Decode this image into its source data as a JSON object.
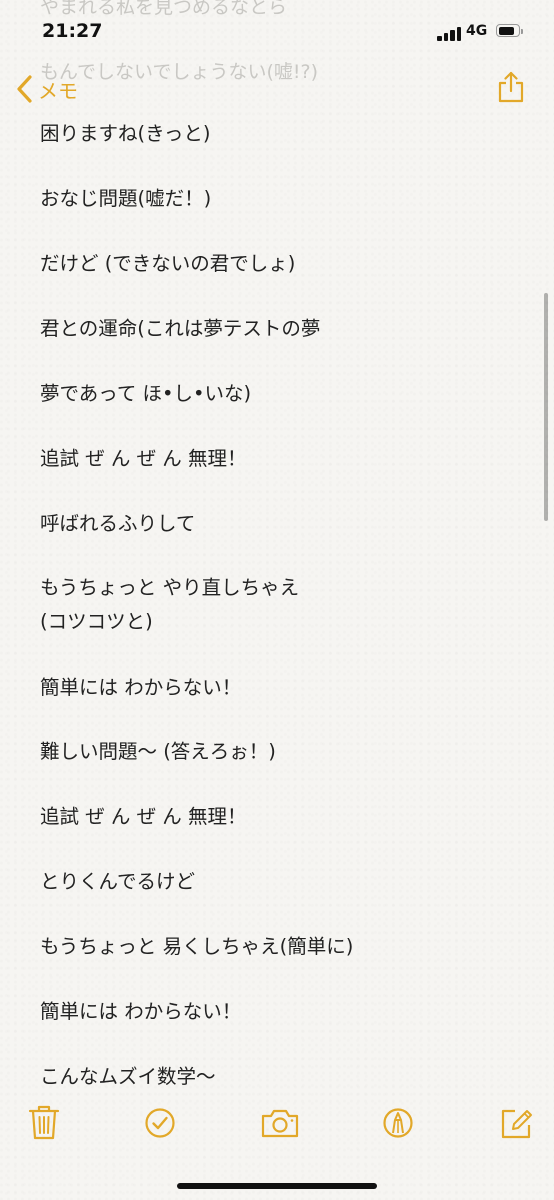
{
  "status": {
    "time": "21:27",
    "network": "4G"
  },
  "nav": {
    "back_label": "メモ"
  },
  "faded_lines": [
    "やまれる私を見つめるなとら",
    "もんでしないでしょうない(嘘!?)"
  ],
  "note": {
    "lines": [
      "困りますね(きっと)",
      "おなじ問題(嘘だ！)",
      "だけど (できないの君でしょ)",
      "君との運命(これは夢テストの夢",
      "夢であって ほ•し•いな)",
      "追試 ぜ ん ぜ ん 無理！",
      "呼ばれるふりして",
      "もうちょっと やり直しちゃえ",
      "(コツコツと)",
      "簡単には わからない！",
      "難しい問題〜 (答えろぉ！)",
      "追試 ぜ ん ぜ ん 無理！",
      "とりくんでるけど",
      "もうちょっと 易くしちゃえ(簡単に)",
      "簡単には わからない！",
      "こんなムズイ数学〜"
    ]
  },
  "colors": {
    "accent": "#e2a829",
    "background": "#f6f5f2",
    "text": "#222222"
  },
  "toolbar": {
    "icons": [
      "trash-icon",
      "checklist-icon",
      "camera-icon",
      "markup-icon",
      "compose-icon"
    ]
  }
}
